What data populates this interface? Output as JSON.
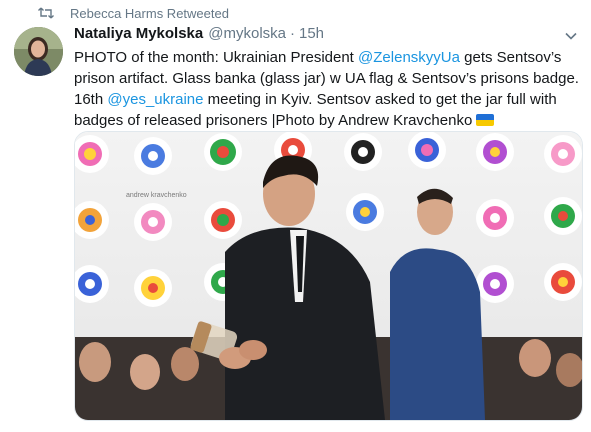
{
  "retweet": {
    "text": "Rebecca Harms Retweeted",
    "icon": "retweet-icon"
  },
  "tweet": {
    "author_name": "Nataliya Mykolska",
    "author_handle": "@mykolska",
    "separator": "·",
    "time": "15h",
    "text_parts": {
      "p1": "PHOTO of the month: Ukrainian President ",
      "m1": "@ZelenskyyUa",
      "p2": " gets Sentsov’s prison artifact. Glass banka (glass jar) w UA flag & Sentsov’s prisons badge. 16th ",
      "m2": "@yes_ukraine",
      "p3": " meeting in Kyiv. Sentsov asked to get the jar full with badges of released prisoners |Photo by Andrew Kravchenko "
    },
    "photo_watermark": "andrew kravchenko"
  },
  "colors": {
    "link": "#1b95e0",
    "muted": "#657786",
    "text": "#14171a",
    "flag_blue": "#1f6fd6",
    "flag_yellow": "#f7c900"
  }
}
